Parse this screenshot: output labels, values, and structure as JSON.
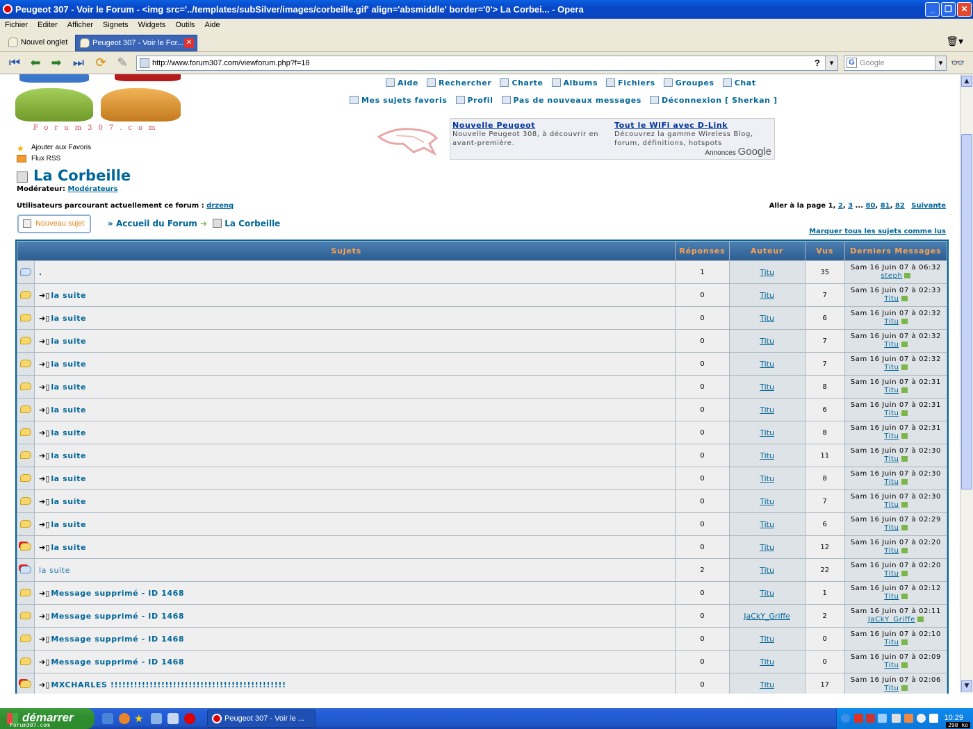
{
  "window": {
    "title": "Peugeot 307 - Voir le Forum - <img src='../templates/subSilver/images/corbeille.gif' align='absmiddle' border='0'> La Corbei... - Opera"
  },
  "menu": [
    "Fichier",
    "Editer",
    "Afficher",
    "Signets",
    "Widgets",
    "Outils",
    "Aide"
  ],
  "tabs": [
    {
      "label": "Nouvel onglet"
    },
    {
      "label": "Peugeot 307 - Voir le For..."
    }
  ],
  "address": {
    "url": "http://www.forum307.com/viewforum.php?f=18",
    "help": "?"
  },
  "search": {
    "placeholder": "Google",
    "engine_icon": "G"
  },
  "site": {
    "logo_text": "Forum307.com",
    "side_links": [
      "Ajouter aux Favoris",
      "Flux RSS"
    ],
    "top_links_1": [
      "Aide",
      "Rechercher",
      "Charte",
      "Albums",
      "Fichiers",
      "Groupes",
      "Chat"
    ],
    "top_links_2": [
      "Mes sujets favoris",
      "Profil",
      "Pas de nouveaux messages",
      "Déconnexion [ Sherkan ]"
    ],
    "ads": [
      {
        "title": "Nouvelle Peugeot",
        "text": "Nouvelle Peugeot 308, à découvrir en avant-première."
      },
      {
        "title": "Tout le WiFi avec D-Link",
        "text": "Découvrez la gamme Wireless Blog, forum, définitions, hotspots"
      }
    ],
    "ads_by": "Annonces",
    "ads_brand": "Google"
  },
  "forum": {
    "title": "La Corbeille",
    "moderator_label": "Modérateur:",
    "moderator_link": "Modérateurs",
    "users_label": "Utilisateurs parcourant actuellement ce forum :",
    "users_link": "drzenq",
    "pages_label": "Aller à la page",
    "pages": [
      "1",
      "2",
      "3",
      "...",
      "80",
      "81",
      "82"
    ],
    "next": "Suivante",
    "new_topic": "Nouveau sujet",
    "breadcrumb_home": "Accueil du Forum",
    "breadcrumb_current": "La Corbeille",
    "mark_read": "Marquer tous les sujets comme lus",
    "columns": [
      "Sujets",
      "Réponses",
      "Auteur",
      "Vus",
      "Derniers Messages"
    ],
    "rows": [
      {
        "icon": "b",
        "moved": false,
        "title": ".",
        "replies": "1",
        "author": "Titu",
        "views": "35",
        "last_date": "Sam 16 Juin 07 à 06:32",
        "last_user": "steph"
      },
      {
        "icon": "y",
        "moved": true,
        "title": "la suite",
        "replies": "0",
        "author": "Titu",
        "views": "7",
        "last_date": "Sam 16 Juin 07 à 02:33",
        "last_user": "Titu"
      },
      {
        "icon": "y",
        "moved": true,
        "title": "la suite",
        "replies": "0",
        "author": "Titu",
        "views": "6",
        "last_date": "Sam 16 Juin 07 à 02:32",
        "last_user": "Titu"
      },
      {
        "icon": "y",
        "moved": true,
        "title": "la suite",
        "replies": "0",
        "author": "Titu",
        "views": "7",
        "last_date": "Sam 16 Juin 07 à 02:32",
        "last_user": "Titu"
      },
      {
        "icon": "y",
        "moved": true,
        "title": "la suite",
        "replies": "0",
        "author": "Titu",
        "views": "7",
        "last_date": "Sam 16 Juin 07 à 02:32",
        "last_user": "Titu"
      },
      {
        "icon": "y",
        "moved": true,
        "title": "la suite",
        "replies": "0",
        "author": "Titu",
        "views": "8",
        "last_date": "Sam 16 Juin 07 à 02:31",
        "last_user": "Titu"
      },
      {
        "icon": "y",
        "moved": true,
        "title": "la suite",
        "replies": "0",
        "author": "Titu",
        "views": "6",
        "last_date": "Sam 16 Juin 07 à 02:31",
        "last_user": "Titu"
      },
      {
        "icon": "y",
        "moved": true,
        "title": "la suite",
        "replies": "0",
        "author": "Titu",
        "views": "8",
        "last_date": "Sam 16 Juin 07 à 02:31",
        "last_user": "Titu"
      },
      {
        "icon": "y",
        "moved": true,
        "title": "la suite",
        "replies": "0",
        "author": "Titu",
        "views": "11",
        "last_date": "Sam 16 Juin 07 à 02:30",
        "last_user": "Titu"
      },
      {
        "icon": "y",
        "moved": true,
        "title": "la suite",
        "replies": "0",
        "author": "Titu",
        "views": "8",
        "last_date": "Sam 16 Juin 07 à 02:30",
        "last_user": "Titu"
      },
      {
        "icon": "y",
        "moved": true,
        "title": "la suite",
        "replies": "0",
        "author": "Titu",
        "views": "7",
        "last_date": "Sam 16 Juin 07 à 02:30",
        "last_user": "Titu"
      },
      {
        "icon": "y",
        "moved": true,
        "title": "la suite",
        "replies": "0",
        "author": "Titu",
        "views": "6",
        "last_date": "Sam 16 Juin 07 à 02:29",
        "last_user": "Titu"
      },
      {
        "icon": "lock",
        "moved": true,
        "title": "la suite",
        "replies": "0",
        "author": "Titu",
        "views": "12",
        "last_date": "Sam 16 Juin 07 à 02:20",
        "last_user": "Titu"
      },
      {
        "icon": "block",
        "moved": false,
        "plain": true,
        "title": "la suite",
        "replies": "2",
        "author": "Titu",
        "views": "22",
        "last_date": "Sam 16 Juin 07 à 02:20",
        "last_user": "Titu"
      },
      {
        "icon": "y",
        "moved": true,
        "title": "Message supprimé - ID 1468",
        "replies": "0",
        "author": "Titu",
        "views": "1",
        "last_date": "Sam 16 Juin 07 à 02:12",
        "last_user": "Titu"
      },
      {
        "icon": "y",
        "moved": true,
        "title": "Message supprimé - ID 1468",
        "replies": "0",
        "author": "JaCkY_Griffe",
        "views": "2",
        "last_date": "Sam 16 Juin 07 à 02:11",
        "last_user": "JaCkY_Griffe"
      },
      {
        "icon": "y",
        "moved": true,
        "title": "Message supprimé - ID 1468",
        "replies": "0",
        "author": "Titu",
        "views": "0",
        "last_date": "Sam 16 Juin 07 à 02:10",
        "last_user": "Titu"
      },
      {
        "icon": "y",
        "moved": true,
        "title": "Message supprimé - ID 1468",
        "replies": "0",
        "author": "Titu",
        "views": "0",
        "last_date": "Sam 16 Juin 07 à 02:09",
        "last_user": "Titu"
      },
      {
        "icon": "lock",
        "moved": true,
        "title": "MXCHARLES !!!!!!!!!!!!!!!!!!!!!!!!!!!!!!!!!!!!!!!!!!!!!",
        "replies": "0",
        "author": "Titu",
        "views": "17",
        "last_date": "Sam 16 Juin 07 à 02:06",
        "last_user": "Titu"
      }
    ]
  },
  "taskbar": {
    "start": "démarrer",
    "start_sub": "Forum307.com",
    "task": "Peugeot 307 - Voir le ...",
    "clock": "10:29",
    "speed": "290 ko"
  },
  "colors": {
    "link": "#006699",
    "header_text": "#ffa34f",
    "title_bar": "#0a5fe0"
  }
}
